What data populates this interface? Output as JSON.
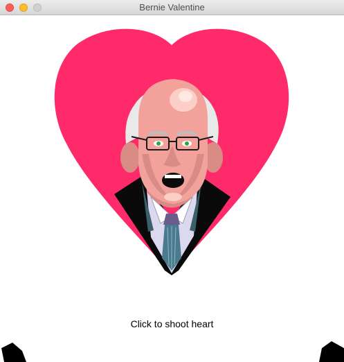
{
  "window": {
    "title": "Bernie Valentine"
  },
  "canvas": {
    "instruction": "Click to shoot heart"
  },
  "colors": {
    "heart": "#fe2a6a",
    "background": "#ffffff",
    "cannon": "#000000"
  },
  "icons": {
    "left_cannon": "cannon-left-icon",
    "right_cannon": "cannon-right-icon"
  }
}
